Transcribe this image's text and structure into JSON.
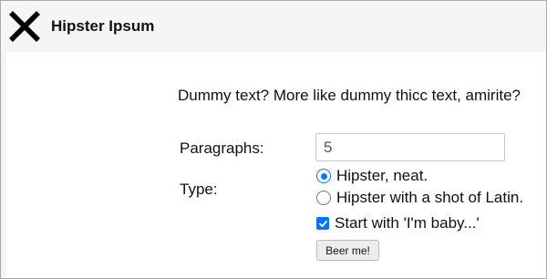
{
  "header": {
    "logo_icon": "x-cross-icon",
    "title": "Hipster Ipsum"
  },
  "main": {
    "tagline": "Dummy text? More like dummy thicc text, amirite?",
    "form": {
      "paragraphs_label": "Paragraphs:",
      "paragraphs_value": "5",
      "type_label": "Type:",
      "type_options": [
        {
          "label": "Hipster, neat.",
          "selected": true
        },
        {
          "label": "Hipster with a shot of Latin.",
          "selected": false
        }
      ],
      "start_with_label": "Start with 'I'm baby...'",
      "start_with_checked": true,
      "submit_label": "Beer me!"
    }
  },
  "colors": {
    "accent": "#0075ff",
    "header_bg": "#f5f5f5"
  }
}
